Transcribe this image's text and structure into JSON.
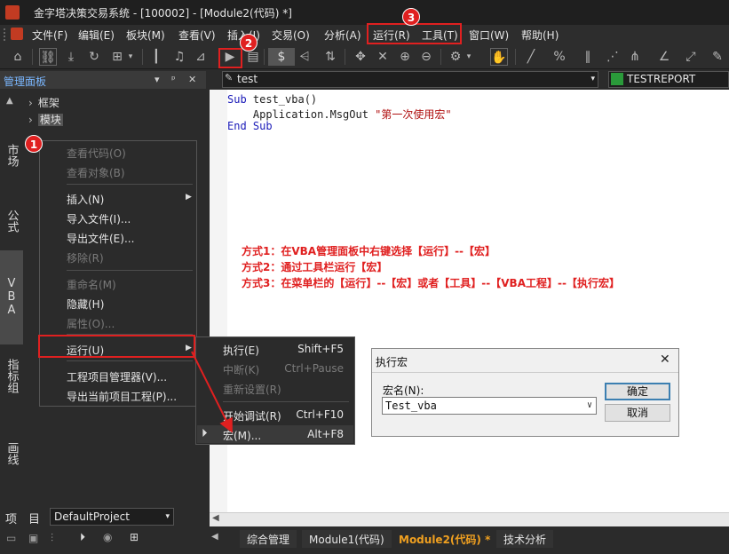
{
  "window": {
    "title": "金字塔决策交易系统 - [100002] - [Module2(代码) *]"
  },
  "menubar": {
    "items": [
      "文件(F)",
      "编辑(E)",
      "板块(M)",
      "查看(V)",
      "插入(I)",
      "交易(O)",
      "分析(A)",
      "运行(R)",
      "工具(T)",
      "窗口(W)",
      "帮助(H)"
    ]
  },
  "left_panel": {
    "title": "管理面板",
    "vertical_tabs": [
      "市场",
      "公式",
      "VBA",
      "指标组",
      "画线"
    ],
    "tree": [
      {
        "label": "框架"
      },
      {
        "label": "模块"
      }
    ],
    "project_label": "项　目",
    "project_select": "DefaultProject"
  },
  "context_menu": {
    "items": [
      {
        "label": "查看代码(O)",
        "disabled": true
      },
      {
        "label": "查看对象(B)",
        "disabled": true
      },
      {
        "label": "插入(N)",
        "disabled": false
      },
      {
        "label": "导入文件(I)...",
        "disabled": false
      },
      {
        "label": "导出文件(E)...",
        "disabled": false
      },
      {
        "label": "移除(R)",
        "disabled": true
      },
      {
        "label": "重命名(M)",
        "disabled": true
      },
      {
        "label": "隐藏(H)",
        "disabled": false
      },
      {
        "label": "属性(O)...",
        "disabled": true
      },
      {
        "label": "运行(U)",
        "disabled": false
      },
      {
        "label": "工程项目管理器(V)...",
        "disabled": false
      },
      {
        "label": "导出当前项目工程(P)...",
        "disabled": false
      }
    ]
  },
  "submenu": {
    "items": [
      {
        "label": "执行(E)",
        "shortcut": "Shift+F5",
        "disabled": false
      },
      {
        "label": "中断(K)",
        "shortcut": "Ctrl+Pause",
        "disabled": true
      },
      {
        "label": "重新设置(R)",
        "shortcut": "",
        "disabled": true
      },
      {
        "label": "开始调试(R)",
        "shortcut": "Ctrl+F10",
        "disabled": false
      },
      {
        "label": "宏(M)...",
        "shortcut": "Alt+F8",
        "disabled": false
      }
    ]
  },
  "editor": {
    "object_combo": "test",
    "proc_combo": "TESTREPORT",
    "code": {
      "line1_kw": "Sub",
      "line1_rest": " test_vba()",
      "line2_plain": "    Application.MsgOut ",
      "line2_str": "\"第一次使用宏\"",
      "line3_kw": "End Sub"
    },
    "notes": [
      "方式1：在VBA管理面板中右键选择【运行】--【宏】",
      "方式2：通过工具栏运行【宏】",
      "方式3：在菜单栏的【运行】--【宏】或者【工具】--【VBA工程】--【执行宏】"
    ]
  },
  "bottom_tabs": [
    "综合管理",
    "Module1(代码)",
    "Module2(代码) *",
    "技术分析"
  ],
  "dialog": {
    "title": "执行宏",
    "label": "宏名(N):",
    "value": "Test_vba",
    "ok": "确定",
    "cancel": "取消"
  },
  "badges": [
    "1",
    "2",
    "3"
  ],
  "colors": {
    "accent_red": "#e02020",
    "panel_title": "#7ab7ff",
    "active_tab": "#f0a020"
  }
}
